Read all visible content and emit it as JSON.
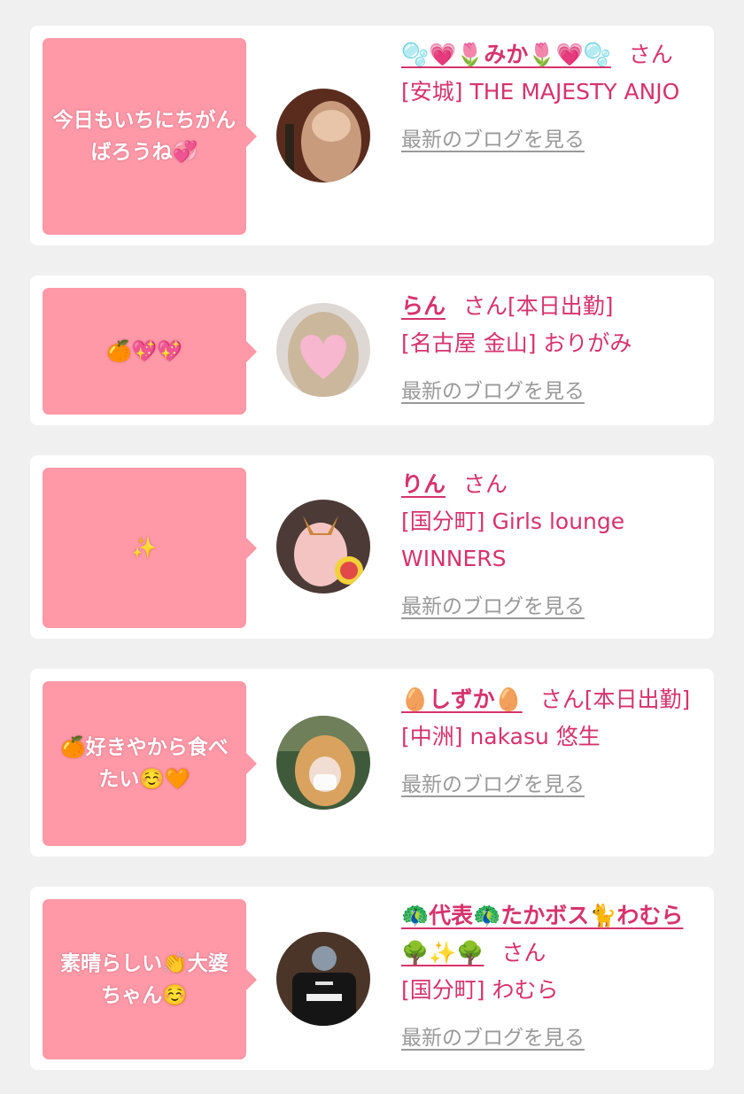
{
  "cast": [
    {
      "comment": "今日もいちにちがんばろうね💞",
      "name": "🫧💗🌷みか🌷💗🫧",
      "suffix": "さん",
      "status": "",
      "shop": "[安城] THE MAJESTY ANJO",
      "blog_link": "最新のブログを見る",
      "avatar_colors": [
        "#5a2c1e",
        "#c79b7c"
      ]
    },
    {
      "comment": "🍊💖💖",
      "name": "らん",
      "suffix": "さん",
      "status": "[本日出勤]",
      "shop": "[名古屋 金山] おりがみ",
      "blog_link": "最新のブログを見る",
      "avatar_colors": [
        "#ddd8d4",
        "#f7b7cf"
      ]
    },
    {
      "comment": "✨",
      "name": "りん",
      "suffix": "さん",
      "status": "",
      "shop": "[国分町] Girls lounge WINNERS",
      "blog_link": "最新のブログを見る",
      "avatar_colors": [
        "#4b3a36",
        "#f3c4c1"
      ]
    },
    {
      "comment": "🍊好きやから食べたい☺️🧡",
      "name": "🥚しずか🥚",
      "suffix": "さん",
      "status": "[本日出勤]",
      "shop": "[中洲] nakasu 悠生",
      "blog_link": "最新のブログを見る",
      "avatar_colors": [
        "#3f5a3a",
        "#d9a35f"
      ]
    },
    {
      "comment": "素晴らしい👏大婆ちゃん☺️",
      "name": "🦚代表🦚たかボス🐈わむら🌳✨🌳",
      "suffix": "さん",
      "status": "",
      "shop": "[国分町] わむら",
      "blog_link": "最新のブログを見る",
      "avatar_colors": [
        "#4a3528",
        "#151515"
      ]
    }
  ]
}
